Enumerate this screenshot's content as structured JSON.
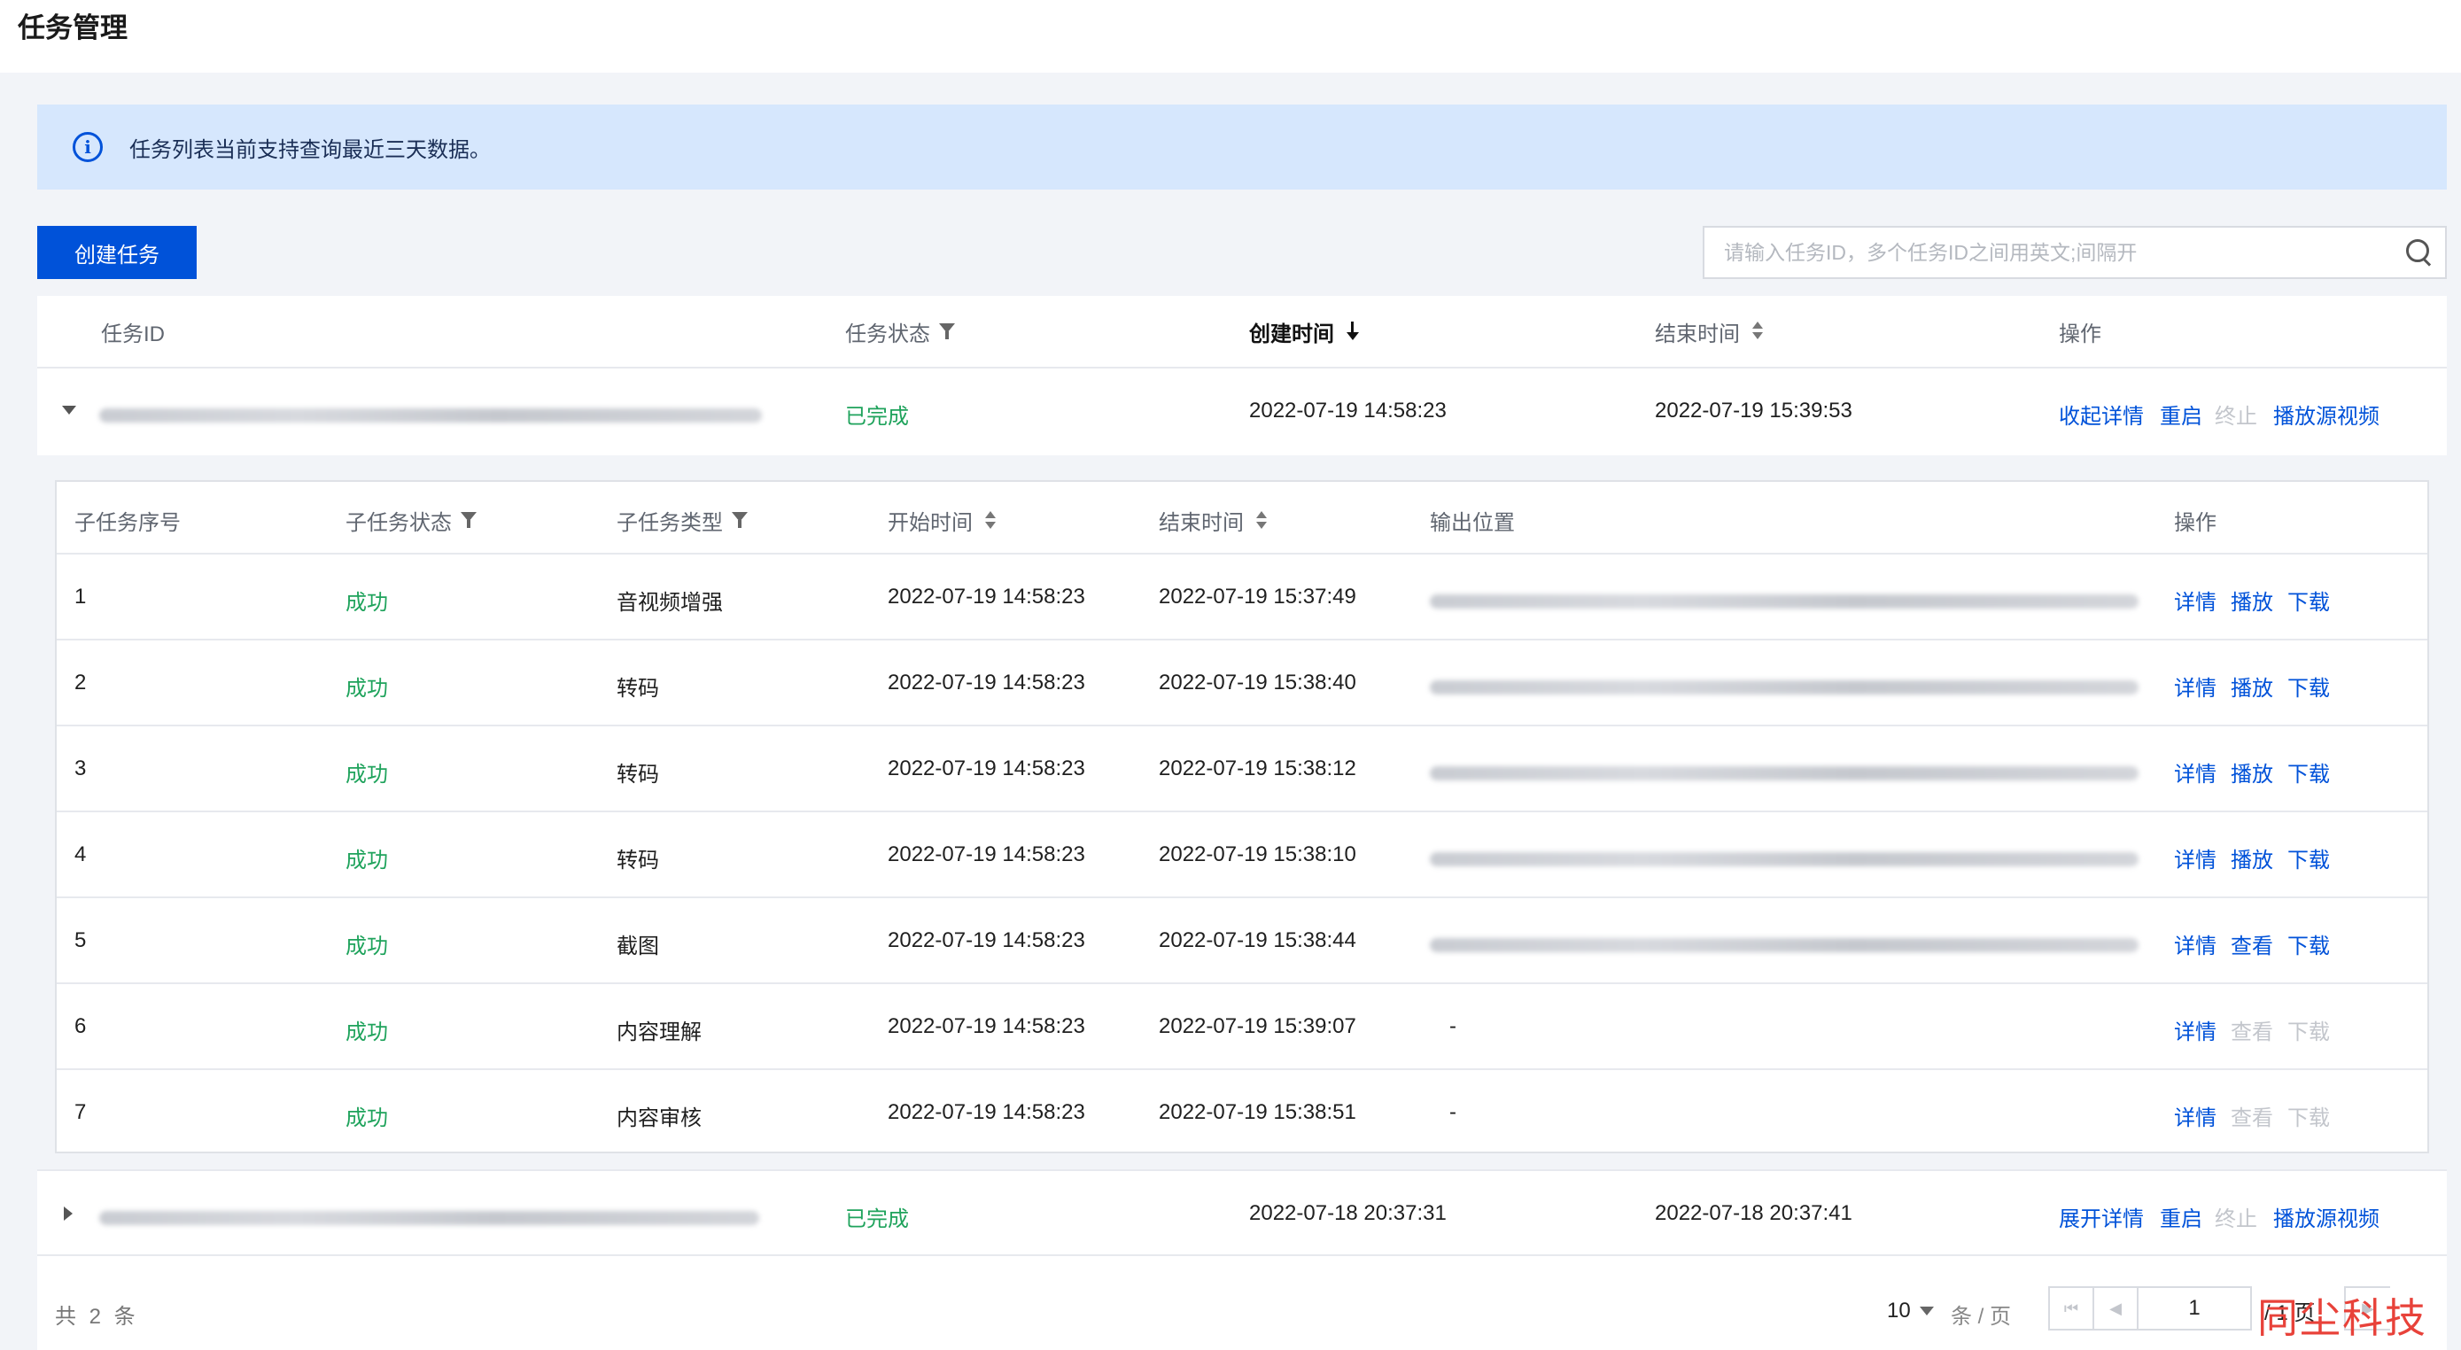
{
  "page": {
    "title": "任务管理"
  },
  "notice": {
    "text": "任务列表当前支持查询最近三天数据。"
  },
  "toolbar": {
    "create_label": "创建任务",
    "search_placeholder": "请输入任务ID，多个任务ID之间用英文;间隔开"
  },
  "table": {
    "headers": {
      "id": "任务ID",
      "status": "任务状态",
      "created": "创建时间",
      "ended": "结束时间",
      "actions": "操作"
    },
    "rows": [
      {
        "status": "已完成",
        "created": "2022-07-19 14:58:23",
        "ended": "2022-07-19 15:39:53",
        "actions": {
          "toggle": "收起详情",
          "restart": "重启",
          "stop": "终止",
          "play": "播放源视频"
        }
      },
      {
        "status": "已完成",
        "created": "2022-07-18 20:37:31",
        "ended": "2022-07-18 20:37:41",
        "actions": {
          "toggle": "展开详情",
          "restart": "重启",
          "stop": "终止",
          "play": "播放源视频"
        }
      }
    ]
  },
  "subtable": {
    "headers": {
      "seq": "子任务序号",
      "status": "子任务状态",
      "type": "子任务类型",
      "start": "开始时间",
      "end": "结束时间",
      "output": "输出位置",
      "actions": "操作"
    },
    "rows": [
      {
        "seq": "1",
        "status": "成功",
        "type": "音视频增强",
        "start": "2022-07-19 14:58:23",
        "end": "2022-07-19 15:37:49",
        "output": "",
        "a1": "详情",
        "a2": "播放",
        "a3": "下载",
        "enabled": true
      },
      {
        "seq": "2",
        "status": "成功",
        "type": "转码",
        "start": "2022-07-19 14:58:23",
        "end": "2022-07-19 15:38:40",
        "output": "",
        "a1": "详情",
        "a2": "播放",
        "a3": "下载",
        "enabled": true
      },
      {
        "seq": "3",
        "status": "成功",
        "type": "转码",
        "start": "2022-07-19 14:58:23",
        "end": "2022-07-19 15:38:12",
        "output": "",
        "a1": "详情",
        "a2": "播放",
        "a3": "下载",
        "enabled": true
      },
      {
        "seq": "4",
        "status": "成功",
        "type": "转码",
        "start": "2022-07-19 14:58:23",
        "end": "2022-07-19 15:38:10",
        "output": "",
        "a1": "详情",
        "a2": "播放",
        "a3": "下载",
        "enabled": true
      },
      {
        "seq": "5",
        "status": "成功",
        "type": "截图",
        "start": "2022-07-19 14:58:23",
        "end": "2022-07-19 15:38:44",
        "output": "",
        "a1": "详情",
        "a2": "查看",
        "a3": "下载",
        "enabled": true
      },
      {
        "seq": "6",
        "status": "成功",
        "type": "内容理解",
        "start": "2022-07-19 14:58:23",
        "end": "2022-07-19 15:39:07",
        "output": "-",
        "a1": "详情",
        "a2": "查看",
        "a3": "下载",
        "enabled": false
      },
      {
        "seq": "7",
        "status": "成功",
        "type": "内容审核",
        "start": "2022-07-19 14:58:23",
        "end": "2022-07-19 15:38:51",
        "output": "-",
        "a1": "详情",
        "a2": "查看",
        "a3": "下载",
        "enabled": false
      }
    ]
  },
  "footer": {
    "total": "共 2 条",
    "page_size": "10",
    "per_page": "条 / 页",
    "page": "1",
    "page_total": "/ 1 页"
  },
  "watermark": "同尘科技",
  "colors": {
    "primary": "#0052d9",
    "success": "#1fa35c",
    "disabled": "#c3c6cc"
  }
}
